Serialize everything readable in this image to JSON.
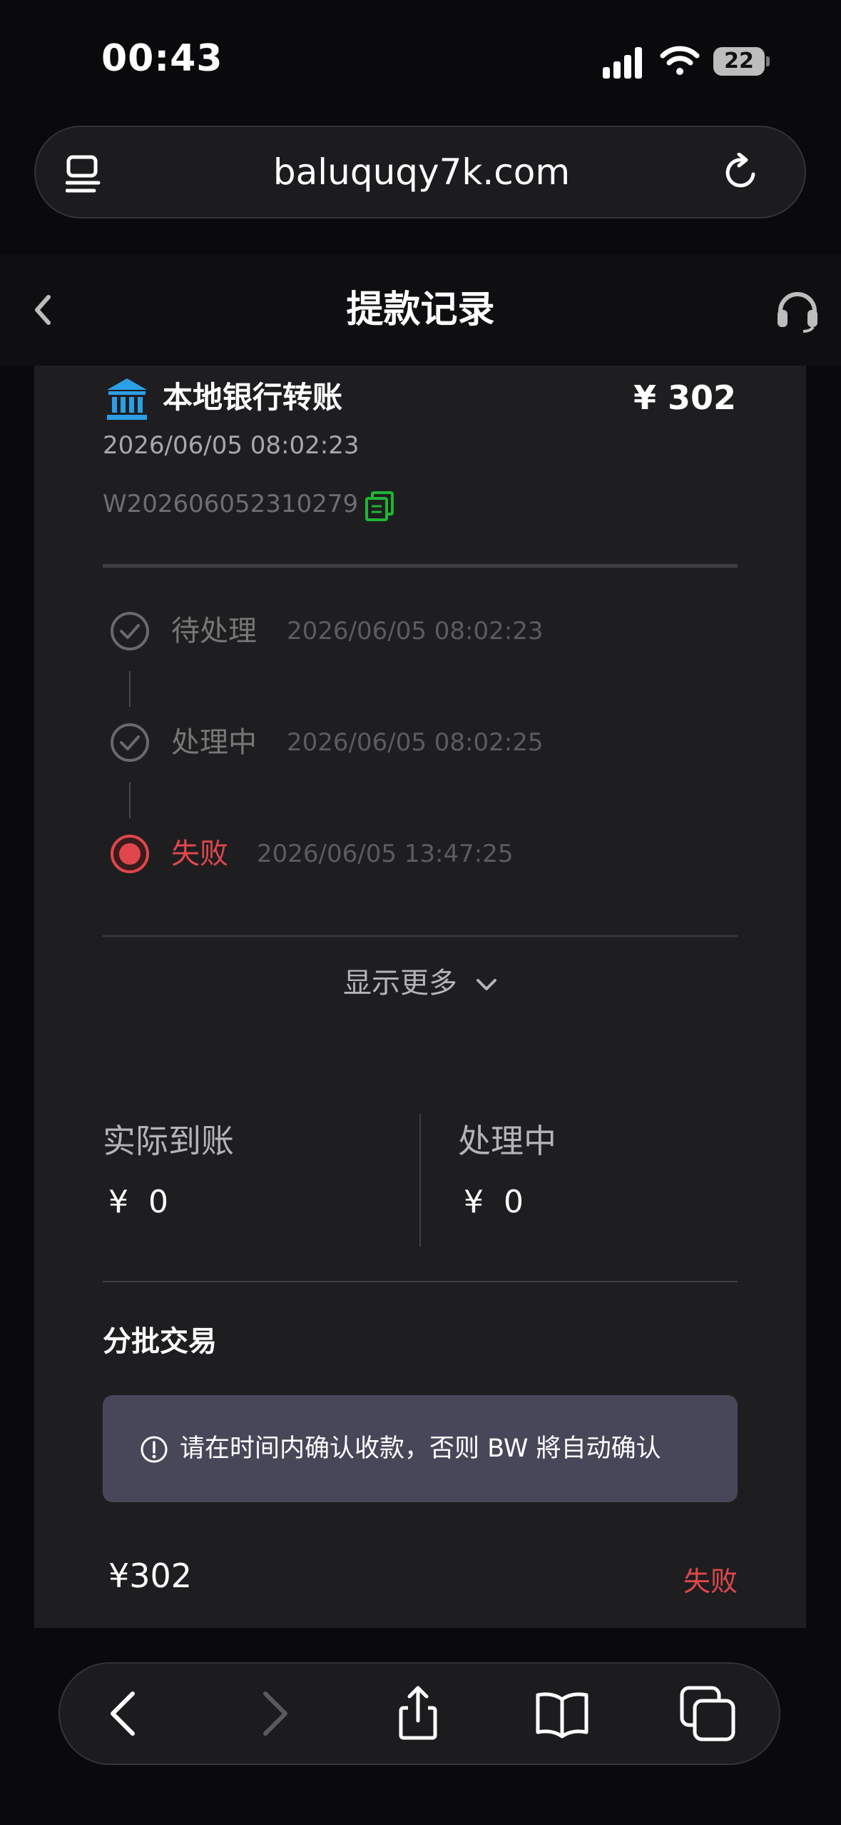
{
  "status_bar": {
    "time": "00:43",
    "battery": "22"
  },
  "browser": {
    "url": "baluquqy7k.com"
  },
  "header": {
    "title": "提款记录"
  },
  "record": {
    "method": "本地银行转账",
    "amount": "¥ 302",
    "created_time": "2026/06/05 08:02:23",
    "order_no": "W202606052310279",
    "steps": [
      {
        "label": "待处理",
        "time": "2026/06/05 08:02:23",
        "state": "done"
      },
      {
        "label": "处理中",
        "time": "2026/06/05 08:02:25",
        "state": "done"
      },
      {
        "label": "失败",
        "time": "2026/06/05 13:47:25",
        "state": "failed"
      }
    ],
    "show_more": "显示更多",
    "actual_received_label": "实际到账",
    "actual_received_value": "¥  0",
    "processing_label": "处理中",
    "processing_value": "¥  0",
    "batch_title": "分批交易",
    "notice": "请在时间内确认收款，否则 BW 將自动确认",
    "batch_amount": "¥302",
    "batch_status": "失败"
  },
  "colors": {
    "failed": "#e0474c",
    "bank_icon": "#2b9fe6",
    "copy_icon": "#1fb436",
    "notice_bg": "#48475a"
  }
}
